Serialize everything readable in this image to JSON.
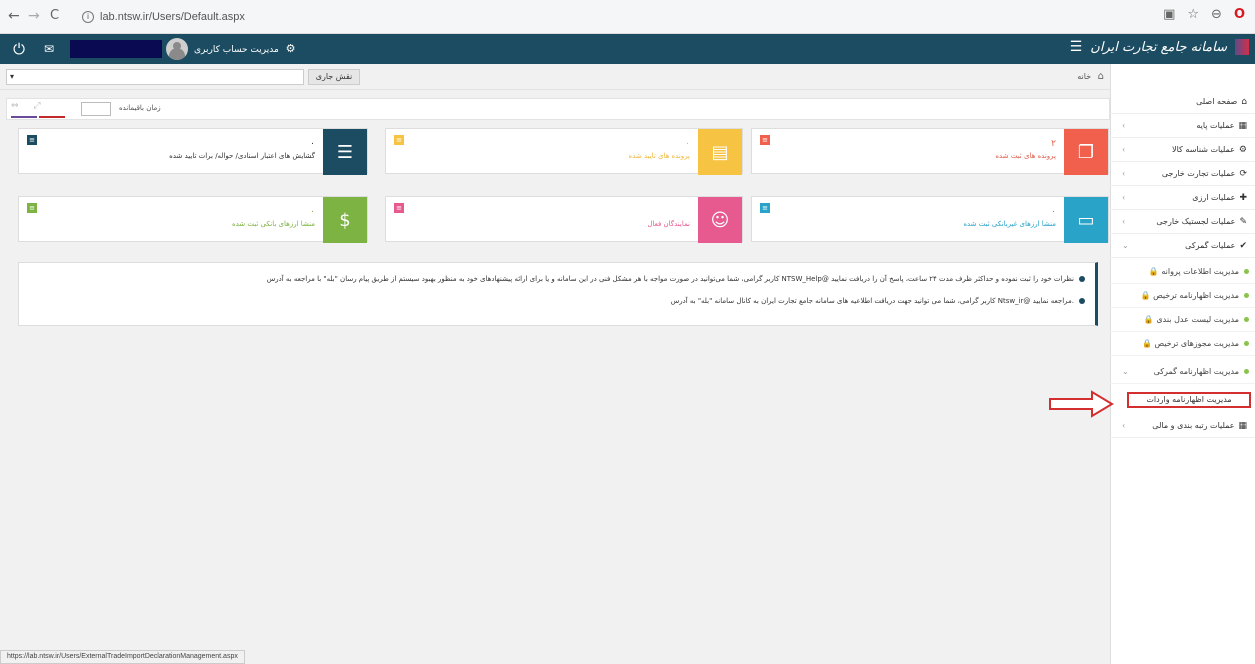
{
  "browser": {
    "url": "lab.ntsw.ir/Users/Default.aspx",
    "status_url": "https://lab.ntsw.ir/Users/ExternalTradeImportDeclarationManagement.aspx"
  },
  "topbar": {
    "account_label": "مدیریت حساب کاربری",
    "brand": "سامانه جامع تجارت ایران"
  },
  "rolebar": {
    "role_label": "نقش جاری",
    "breadcrumb_home": "خانه"
  },
  "timer": {
    "label": "زمان باقیمانده"
  },
  "cards": [
    {
      "num": "۲",
      "label": "پرونده های ثبت شده",
      "color": "#f0604d",
      "textcolor": "#e0604d"
    },
    {
      "num": "۰",
      "label": "پرونده های تایید شده",
      "color": "#f6c342",
      "textcolor": "#f0b840"
    },
    {
      "num": "۰",
      "label": "گشایش های اعتبار اسنادی/ حواله/ برات تایید شده",
      "color": "#1c4c62",
      "textcolor": "#333"
    },
    {
      "num": "۰",
      "label": "منشا ارزهای غیربانکی ثبت شده",
      "color": "#2aa3c8",
      "textcolor": "#2aa3c8"
    },
    {
      "num": "",
      "label": "نمایندگان فعال",
      "color": "#e75a8f",
      "textcolor": "#e75a8f"
    },
    {
      "num": "۰",
      "label": "منشا ارزهای بانکی ثبت شده",
      "color": "#7cb342",
      "textcolor": "#7cb342"
    }
  ],
  "announce": [
    "کاربر گرامی، شما می‌توانید در صورت مواجه با هر مشکل فنی در این سامانه و یا برای ارائه پیشنهادهای خود به منظور بهبود سیستم از طریق پیام رسان \"بله\" با مراجعه به آدرس NTSW_Help@ نظرات خود را ثبت نموده و حداکثر ظرف مدت ۲۴ ساعت، پاسخ آن را دریافت نمایید",
    "کاربر گرامی، شما می توانید جهت دریافت اطلاعیه های سامانه جامع تجارت ایران به کانال سامانه \"بله\" به آدرس Ntsw_ir@ مراجعه نمایید."
  ],
  "sidebar": {
    "items": [
      {
        "label": "صفحه اصلی",
        "icon": "home-icon",
        "glyph": "🏠"
      },
      {
        "label": "عملیات پایه",
        "icon": "chart-icon",
        "glyph": "▦"
      },
      {
        "label": "عملیات شناسه کالا",
        "icon": "cogs-icon",
        "glyph": "⚙"
      },
      {
        "label": "عملیات تجارت خارجی",
        "icon": "refresh-icon",
        "glyph": "⟳"
      },
      {
        "label": "عملیات ارزی",
        "icon": "user-plus-icon",
        "glyph": "✚"
      },
      {
        "label": "عملیات لجستیک خارجی",
        "icon": "edit-icon",
        "glyph": "✎"
      },
      {
        "label": "عملیات گمرکی",
        "icon": "check-icon",
        "glyph": "✔"
      }
    ],
    "sub_items": [
      "مدیریت اطلاعات پروانه",
      "مدیریت اظهارنامه ترخیص",
      "مدیریت لیست عدل بندی",
      "مدیریت مجوزهای ترخیص",
      "مدیریت اظهارنامه گمرکی"
    ],
    "active_item": "مدیریت اظهارنامه واردات",
    "last_item": "عملیات رتبه بندی و مالی"
  }
}
